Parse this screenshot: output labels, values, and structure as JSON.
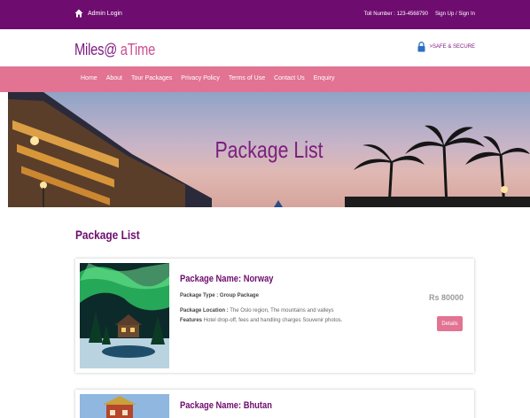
{
  "topbar": {
    "admin_label": "Admin Login",
    "toll": "Toll Number : 123-4568790",
    "signup": "Sign Up / Sign In"
  },
  "header": {
    "logo_main": "Miles@",
    "logo_accent": " aTime",
    "secure": ">SAFE & SECURE"
  },
  "nav": {
    "items": [
      "Home",
      "About",
      "Tour Packages",
      "Privacy Policy",
      "Terms of Use",
      "Contact Us",
      "Enquiry"
    ]
  },
  "hero": {
    "title": "Package List"
  },
  "section": {
    "title": "Package List"
  },
  "packages": [
    {
      "name": "Package Name: Norway",
      "type_label": "Package Type : Group Package",
      "location_label": "Package Location :",
      "location": " The Oslo region, The mountains and valleys",
      "features_label": "Features",
      "features": " Hotel drop-off, fees and handling charges Souvenir photos.",
      "price": "Rs 80000",
      "details": "Details"
    },
    {
      "name": "Package Name: Bhutan"
    }
  ],
  "colors": {
    "brand": "#6e0c6f",
    "nav": "#e27393",
    "accent": "#cb4f91"
  }
}
